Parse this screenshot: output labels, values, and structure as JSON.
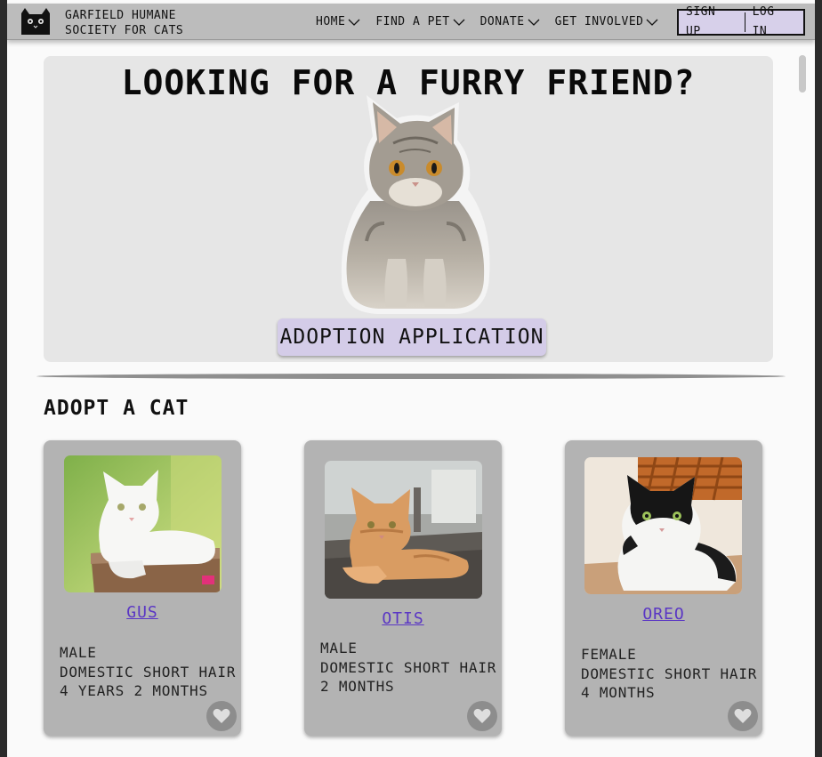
{
  "header": {
    "brand_line1": "GARFIELD HUMANE",
    "brand_line2": "SOCIETY FOR CATS",
    "nav": [
      {
        "label": "HOME"
      },
      {
        "label": "FIND A PET"
      },
      {
        "label": "DONATE"
      },
      {
        "label": "GET INVOLVED"
      }
    ],
    "sign_up": "SIGN UP",
    "log_in": "LOG IN"
  },
  "hero": {
    "title": "LOOKING FOR A FURRY FRIEND?",
    "button": "ADOPTION APPLICATION"
  },
  "adopt": {
    "title": "ADOPT A CAT",
    "cats": [
      {
        "name": "GUS",
        "sex": "MALE",
        "breed": "DOMESTIC SHORT HAIR",
        "age": "4 YEARS 2 MONTHS",
        "photo": "white-cat-on-stump"
      },
      {
        "name": "OTIS",
        "sex": "MALE",
        "breed": "DOMESTIC SHORT HAIR",
        "age": "2 MONTHS",
        "photo": "orange-tabby-kitten"
      },
      {
        "name": "OREO",
        "sex": "FEMALE",
        "breed": "DOMESTIC SHORT HAIR",
        "age": "4 MONTHS",
        "photo": "black-white-longhair"
      }
    ]
  },
  "colors": {
    "header_bg": "#bcbcbc",
    "accent_lavender": "#d4cce8",
    "link_purple": "#5a36c4",
    "card_bg": "#b3b3b3",
    "hero_bg": "#e6e6e6"
  },
  "icons": [
    "cat-logo-icon",
    "chevron-down-icon",
    "heart-icon"
  ]
}
